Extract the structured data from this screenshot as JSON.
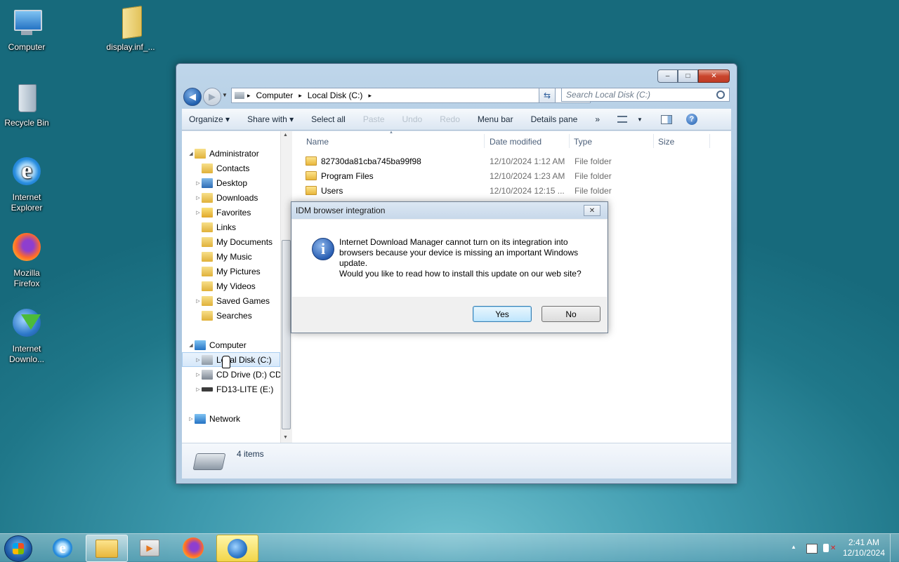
{
  "desktop": {
    "icons": [
      {
        "label": "Computer",
        "icon": "computer-icon"
      },
      {
        "label": "display.inf_...",
        "icon": "folder-icon"
      },
      {
        "label": "Recycle Bin",
        "icon": "recycle-bin-icon"
      },
      {
        "label": "Internet Explorer",
        "icon": "internet-explorer-icon"
      },
      {
        "label": "Mozilla Firefox",
        "icon": "firefox-icon"
      },
      {
        "label": "Internet Downlo...",
        "icon": "idm-icon"
      }
    ]
  },
  "explorer": {
    "caption_buttons": {
      "minimize": "–",
      "maximize": "□",
      "close": "✕"
    },
    "address": {
      "crumbs": [
        "Computer",
        "Local Disk (C:)"
      ],
      "separator": "▸"
    },
    "search": {
      "placeholder": "Search Local Disk (C:)"
    },
    "toolbar": {
      "organize": "Organize ▾",
      "share_with": "Share with ▾",
      "select_all": "Select all",
      "paste": "Paste",
      "undo": "Undo",
      "redo": "Redo",
      "menu_bar": "Menu bar",
      "details_pane": "Details pane",
      "more": "»"
    },
    "nav_tree": [
      {
        "label": "Administrator",
        "expander": "◢"
      },
      {
        "label": "Contacts",
        "expander": ""
      },
      {
        "label": "Desktop",
        "expander": "▷"
      },
      {
        "label": "Downloads",
        "expander": "▷"
      },
      {
        "label": "Favorites",
        "expander": "▷"
      },
      {
        "label": "Links",
        "expander": ""
      },
      {
        "label": "My Documents",
        "expander": ""
      },
      {
        "label": "My Music",
        "expander": ""
      },
      {
        "label": "My Pictures",
        "expander": ""
      },
      {
        "label": "My Videos",
        "expander": ""
      },
      {
        "label": "Saved Games",
        "expander": "▷"
      },
      {
        "label": "Searches",
        "expander": ""
      },
      {
        "label": "Computer",
        "expander": "◢"
      },
      {
        "label": "Local Disk (C:)",
        "expander": "▷",
        "selected": true
      },
      {
        "label": "CD Drive (D:) CDI",
        "expander": "▷"
      },
      {
        "label": "FD13-LITE (E:)",
        "expander": "▷"
      },
      {
        "label": "Network",
        "expander": "▷"
      }
    ],
    "columns": {
      "name": "Name",
      "date": "Date modified",
      "type": "Type",
      "size": "Size"
    },
    "files": [
      {
        "name": "82730da81cba745ba99f98",
        "date": "12/10/2024 1:12 AM",
        "type": "File folder"
      },
      {
        "name": "Program Files",
        "date": "12/10/2024 1:23 AM",
        "type": "File folder"
      },
      {
        "name": "Users",
        "date": "12/10/2024 12:15 ...",
        "type": "File folder"
      }
    ],
    "status": {
      "count": "4 items"
    }
  },
  "dialog": {
    "title": "IDM browser integration",
    "close": "✕",
    "message_line1": "Internet Download Manager cannot turn on its integration into browsers because your device is missing an important Windows update.",
    "message_line2": "Would you like to read how to install this update on our web site?",
    "info_glyph": "i",
    "yes": "Yes",
    "no": "No"
  },
  "taskbar": {
    "time": "2:41 AM",
    "date": "12/10/2024",
    "tray_arrow": "▲"
  }
}
